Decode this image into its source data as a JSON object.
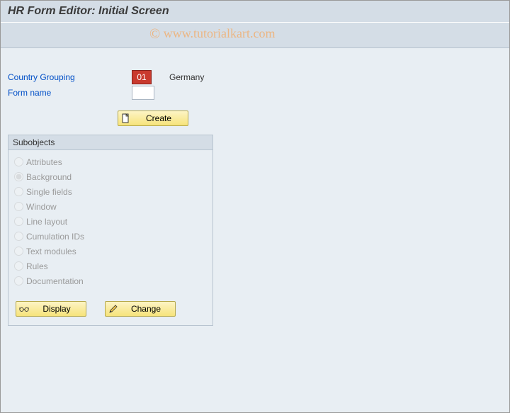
{
  "header": {
    "title": "HR Form Editor: Initial Screen"
  },
  "watermark": "www.tutorialkart.com",
  "fields": {
    "countryGrouping": {
      "label": "Country Grouping",
      "value": "01",
      "meta": "Germany"
    },
    "formName": {
      "label": "Form name",
      "value": ""
    }
  },
  "buttons": {
    "create": "Create",
    "display": "Display",
    "change": "Change"
  },
  "subobjects": {
    "title": "Subobjects",
    "items": [
      {
        "label": "Attributes",
        "selected": false
      },
      {
        "label": "Background",
        "selected": true
      },
      {
        "label": "Single fields",
        "selected": false
      },
      {
        "label": "Window",
        "selected": false
      },
      {
        "label": "Line layout",
        "selected": false
      },
      {
        "label": "Cumulation IDs",
        "selected": false
      },
      {
        "label": "Text modules",
        "selected": false
      },
      {
        "label": "Rules",
        "selected": false
      },
      {
        "label": "Documentation",
        "selected": false
      }
    ]
  }
}
